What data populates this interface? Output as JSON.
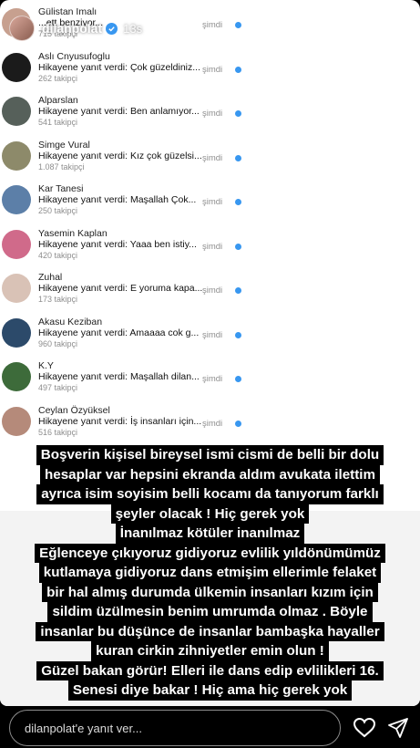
{
  "story": {
    "username": "dilanpolat",
    "posted_time": "13s",
    "progress": 0.6
  },
  "notifications": [
    {
      "name": "Gülistan İmalı",
      "message": "...ett benziyor...",
      "followers": "715 takipçi",
      "time": "şimdi",
      "avatar_color": "#c7a08f"
    },
    {
      "name": "Aslı Cnyusufoglu",
      "message": "Hikayene yanıt verdi: Çok güzeldiniz...",
      "followers": "262 takipçi",
      "time": "şimdi",
      "avatar_color": "#1b1b1b"
    },
    {
      "name": "Alparslan",
      "message": "Hikayene yanıt verdi: Ben anlamıyor...",
      "followers": "541 takipçi",
      "time": "şimdi",
      "avatar_color": "#56605a"
    },
    {
      "name": "Simge Vural",
      "message": "Hikayene yanıt verdi: Kız çok güzelsi...",
      "followers": "1.087 takipçi",
      "time": "şimdi",
      "avatar_color": "#8d8a6a"
    },
    {
      "name": "Kar Tanesi",
      "message": "Hikayene yanıt verdi: Maşallah Çok...",
      "followers": "250 takipçi",
      "time": "şimdi",
      "avatar_color": "#5c7fa8"
    },
    {
      "name": "Yasemin Kaplan",
      "message": "Hikayene yanıt verdi: Yaaa ben istiy...",
      "followers": "420 takipçi",
      "time": "şimdi",
      "avatar_color": "#d06a8a"
    },
    {
      "name": "Zuhal",
      "message": "Hikayene yanıt verdi: E yoruma kapa...",
      "followers": "173 takipçi",
      "time": "şimdi",
      "avatar_color": "#d9c2b6"
    },
    {
      "name": "Akasu Keziban",
      "message": "Hikayene yanıt verdi: Amaaaa cok g...",
      "followers": "960 takipçi",
      "time": "şimdi",
      "avatar_color": "#2c4a6a"
    },
    {
      "name": "K.Y",
      "message": "Hikayene yanıt verdi: Maşallah dilan...",
      "followers": "497 takipçi",
      "time": "şimdi",
      "avatar_color": "#3d6b3a"
    },
    {
      "name": "Ceylan Özyüksel",
      "message": "Hikayene yanıt verdi: İş insanları için...",
      "followers": "516 takipçi",
      "time": "şimdi",
      "avatar_color": "#b58a7a"
    }
  ],
  "caption_lines": [
    "Boşverin kişisel bireysel ismi cismi de belli bir dolu",
    "hesaplar var hepsini ekranda aldım avukata ilettim",
    "ayrıca isim soyisim belli kocamı da tanıyorum farklı",
    "şeyler olacak ! Hiç gerek yok",
    "İnanılmaz kötüler inanılmaz",
    "Eğlenceye çıkıyoruz gidiyoruz evlilik yıldönümümüz",
    "kutlamaya gidiyoruz dans etmişim ellerimle felaket",
    "bir hal almış durumda ülkemin insanları kızım için",
    "sildim üzülmesin benim umrumda olmaz . Böyle",
    "insanlar bu düşünce de insanlar bambaşka hayaller",
    "kuran cirkin zihniyetler emin olun !",
    "Güzel bakan görür! Elleri ile dans edip evlilikleri 16.",
    "Senesi diye bakar ! Hiç ama hiç gerek yok"
  ],
  "reply": {
    "placeholder": "dilanpolat'e yanıt ver..."
  },
  "icons": {
    "play": "play-icon",
    "mute": "speaker-muted-icon",
    "more": "more-dots-icon",
    "like": "heart-icon",
    "share": "send-icon"
  }
}
